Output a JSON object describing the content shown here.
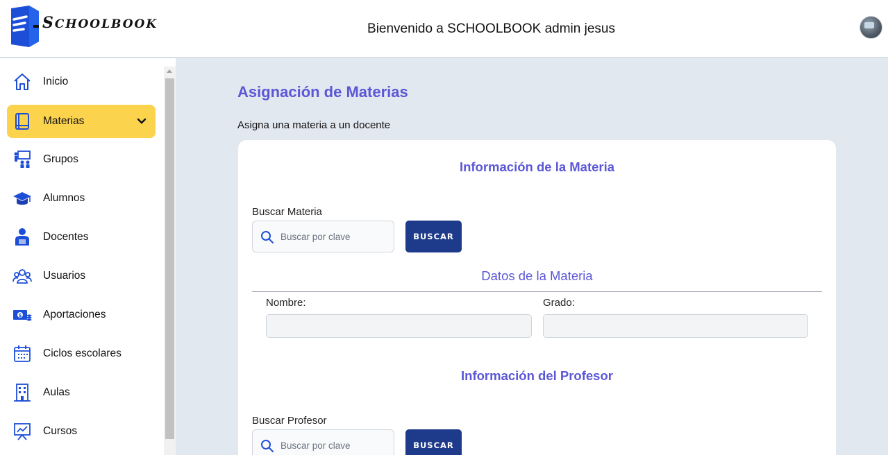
{
  "header": {
    "logo_text_first": "S",
    "logo_text_rest": "CHOOLBOOK",
    "welcome": "Bienvenido a SCHOOLBOOK admin jesus"
  },
  "sidebar": {
    "items": [
      {
        "label": "Inicio",
        "icon": "home-icon"
      },
      {
        "label": "Materias",
        "icon": "book-icon",
        "active": true,
        "expand_icon": "chevron-down-icon"
      },
      {
        "label": "Grupos",
        "icon": "classroom-icon"
      },
      {
        "label": "Alumnos",
        "icon": "graduation-cap-icon"
      },
      {
        "label": "Docentes",
        "icon": "teacher-icon"
      },
      {
        "label": "Usuarios",
        "icon": "users-icon"
      },
      {
        "label": "Aportaciones",
        "icon": "money-icon"
      },
      {
        "label": "Ciclos escolares",
        "icon": "calendar-icon"
      },
      {
        "label": "Aulas",
        "icon": "building-icon"
      },
      {
        "label": "Cursos",
        "icon": "presentation-chart-icon"
      }
    ]
  },
  "main": {
    "title": "Asignación de Materias",
    "subtitle": "Asigna una materia a un docente",
    "materia_section": {
      "title": "Información de la Materia",
      "search_label": "Buscar Materia",
      "search_placeholder": "Buscar por clave",
      "search_button": "BUSCAR",
      "details_title": "Datos de la Materia",
      "nombre_label": "Nombre:",
      "nombre_value": "",
      "grado_label": "Grado:",
      "grado_value": ""
    },
    "profesor_section": {
      "title": "Información del Profesor",
      "search_label": "Buscar Profesor",
      "search_placeholder": "Buscar por clave",
      "search_button": "BUSCAR"
    }
  },
  "colors": {
    "accent": "#5b57d6",
    "active_nav": "#fcd34d",
    "button": "#1e3a8a",
    "icon_blue": "#1d4ed8"
  }
}
